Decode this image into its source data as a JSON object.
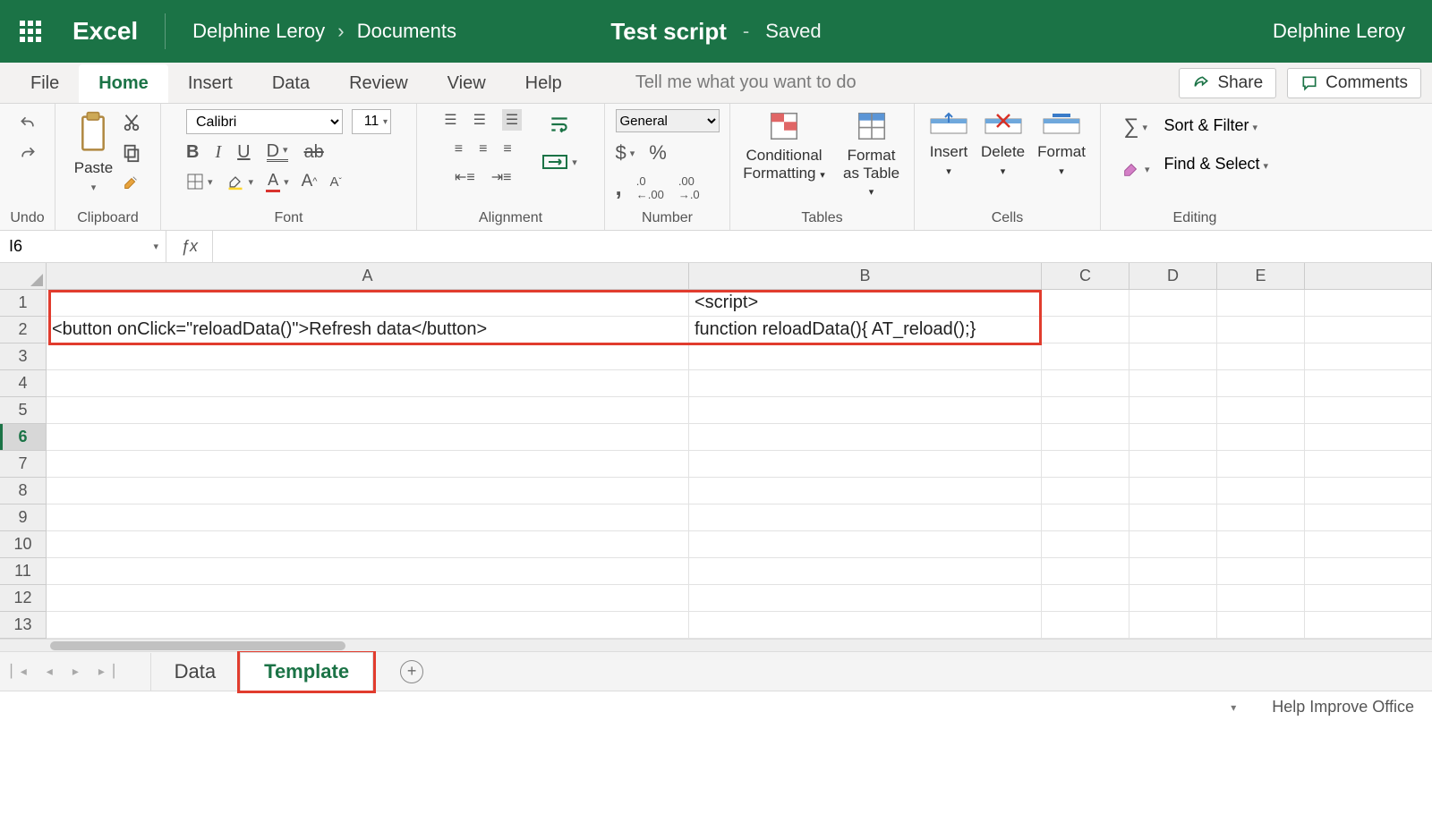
{
  "header": {
    "app_name": "Excel",
    "breadcrumb_user": "Delphine Leroy",
    "breadcrumb_loc": "Documents",
    "doc_title": "Test script",
    "doc_status": "Saved",
    "account": "Delphine Leroy"
  },
  "tabs": {
    "items": [
      "File",
      "Home",
      "Insert",
      "Data",
      "Review",
      "View",
      "Help"
    ],
    "active": "Home",
    "tell_me": "Tell me what you want to do",
    "share": "Share",
    "comments": "Comments"
  },
  "ribbon": {
    "undo": "Undo",
    "clipboard": {
      "paste": "Paste",
      "label": "Clipboard"
    },
    "font": {
      "name": "Calibri",
      "size": "11",
      "label": "Font"
    },
    "alignment": {
      "label": "Alignment"
    },
    "number": {
      "format": "General",
      "label": "Number"
    },
    "tables": {
      "cond": "Conditional Formatting",
      "astable": "Format as Table",
      "label": "Tables"
    },
    "cells": {
      "insert": "Insert",
      "delete": "Delete",
      "format": "Format",
      "label": "Cells"
    },
    "editing": {
      "sort": "Sort & Filter",
      "find": "Find & Select",
      "label": "Editing"
    }
  },
  "formula_bar": {
    "name_box": "I6",
    "value": ""
  },
  "grid": {
    "columns": [
      "A",
      "B",
      "C",
      "D",
      "E"
    ],
    "col_widths": [
      "wA",
      "wB",
      "wC",
      "wD",
      "wE",
      "wF"
    ],
    "row_count": 13,
    "selected_row": 6,
    "cells": {
      "B1": "<script>",
      "A2": "<button onClick=\"reloadData()\">Refresh data</button>",
      "B2": "function reloadData(){ AT_reload();}"
    }
  },
  "sheets": {
    "items": [
      "Data",
      "Template"
    ],
    "active": "Template"
  },
  "status": {
    "help": "Help Improve Office"
  }
}
